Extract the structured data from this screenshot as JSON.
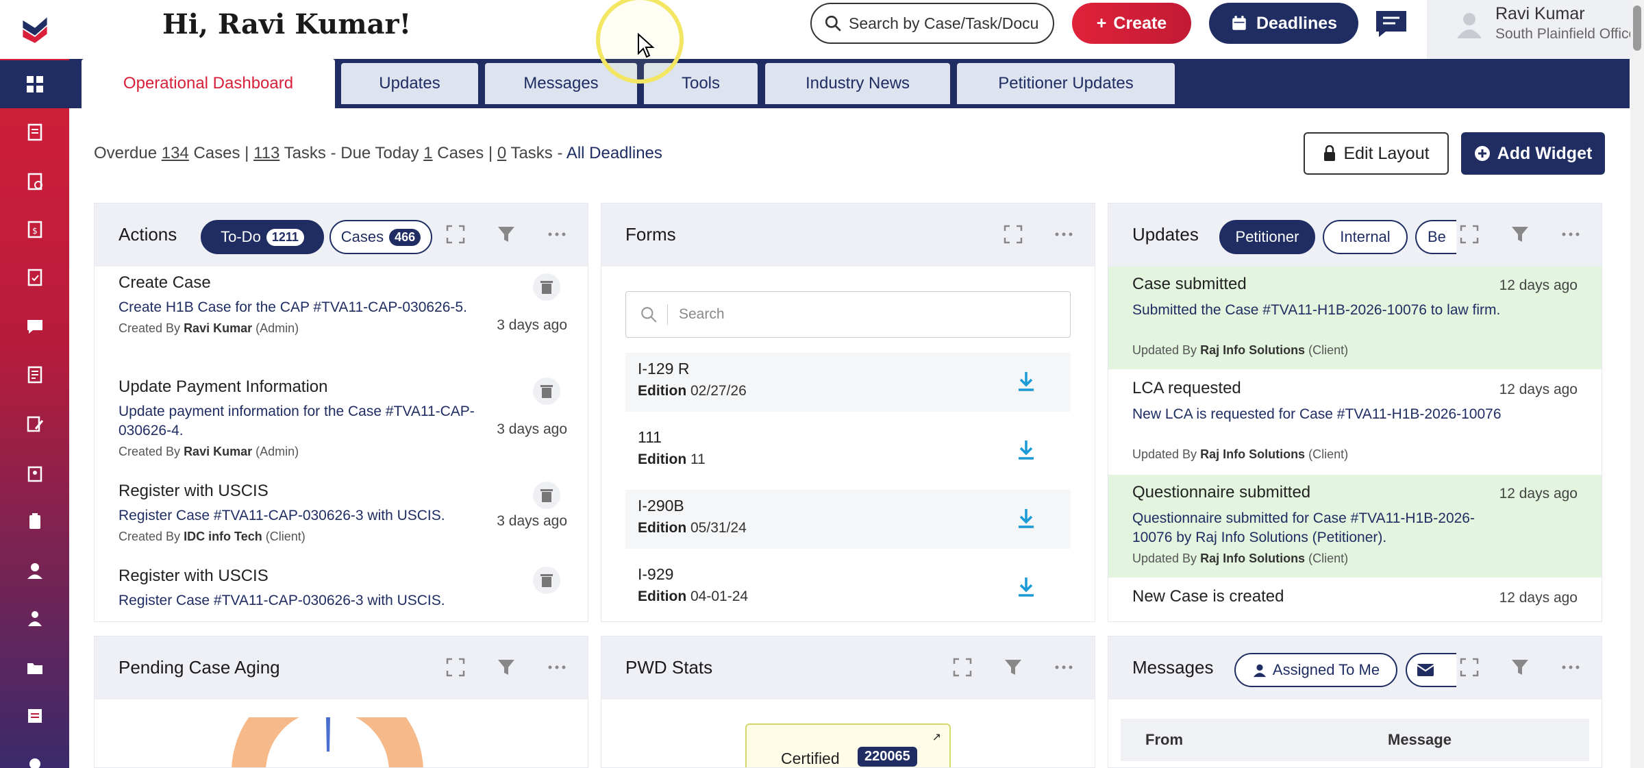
{
  "header": {
    "greeting": "Hi, Ravi Kumar!",
    "search_label": "Search by Case/Task/Docu",
    "create_label": "Create",
    "deadlines_label": "Deadlines",
    "user_name": "Ravi Kumar",
    "user_office": "South Plainfield Office"
  },
  "tabs": [
    {
      "label": "Operational Dashboard",
      "active": true
    },
    {
      "label": "Updates"
    },
    {
      "label": "Messages"
    },
    {
      "label": "Tools"
    },
    {
      "label": "Industry News"
    },
    {
      "label": "Petitioner Updates"
    }
  ],
  "stats": {
    "overdue_prefix": "Overdue",
    "overdue_cases": "134",
    "cases_sep": "Cases |",
    "overdue_tasks": "113",
    "tasks_due_today": "Tasks - Due Today",
    "due_cases": "1",
    "cases_sep2": "Cases |",
    "due_tasks": "0",
    "tasks_sep": "Tasks -",
    "all_deadlines": "All Deadlines"
  },
  "toolbar": {
    "edit_layout": "Edit Layout",
    "add_widget": "Add Widget"
  },
  "actions_widget": {
    "title": "Actions",
    "todo_label": "To-Do",
    "todo_count": "1211",
    "cases_label": "Cases",
    "cases_count": "466",
    "items": [
      {
        "title": "Create Case",
        "desc": "Create H1B Case for the CAP #TVA11-CAP-030626-5.",
        "by_prefix": "Created By",
        "by_name": "Ravi Kumar",
        "by_role": "(Admin)",
        "time": "3 days ago"
      },
      {
        "title": "Update Payment Information",
        "desc": "Update payment information for the Case #TVA11-CAP-030626-4.",
        "by_prefix": "Created By",
        "by_name": "Ravi Kumar",
        "by_role": "(Admin)",
        "time": "3 days ago"
      },
      {
        "title": "Register with USCIS",
        "desc": "Register Case #TVA11-CAP-030626-3 with USCIS.",
        "by_prefix": "Created By",
        "by_name": "IDC info Tech",
        "by_role": "(Client)",
        "time": "3 days ago"
      },
      {
        "title": "Register with USCIS",
        "desc": "Register Case #TVA11-CAP-030626-3 with USCIS.",
        "by_prefix": "",
        "by_name": "",
        "by_role": "",
        "time": ""
      }
    ]
  },
  "forms_widget": {
    "title": "Forms",
    "search_placeholder": "Search",
    "edition_label": "Edition",
    "items": [
      {
        "name": "I-129 R",
        "edition": "02/27/26"
      },
      {
        "name": "111",
        "edition": "11"
      },
      {
        "name": "I-290B",
        "edition": "05/31/24"
      },
      {
        "name": "I-929",
        "edition": "04-01-24"
      }
    ]
  },
  "updates_widget": {
    "title": "Updates",
    "pill_petitioner": "Petitioner",
    "pill_internal": "Internal",
    "pill_third": "Be",
    "items": [
      {
        "title": "Case submitted",
        "desc": "Submitted the Case #TVA11-H1B-2026-10076 to law firm.",
        "by_prefix": "Updated By",
        "by_name": "Raj Info Solutions",
        "by_role": "(Client)",
        "time": "12 days ago",
        "highlight": true
      },
      {
        "title": "LCA requested",
        "desc": "New LCA is requested for Case #TVA11-H1B-2026-10076",
        "by_prefix": "Updated By",
        "by_name": "Raj Info Solutions",
        "by_role": "(Client)",
        "time": "12 days ago",
        "highlight": false
      },
      {
        "title": "Questionnaire submitted",
        "desc": "Questionnaire submitted for Case #TVA11-H1B-2026-10076 by Raj Info Solutions (Petitioner).",
        "by_prefix": "Updated By",
        "by_name": "Raj Info Solutions",
        "by_role": "(Client)",
        "time": "12 days ago",
        "highlight": true
      },
      {
        "title": "New Case is created",
        "desc": "",
        "by_prefix": "",
        "by_name": "",
        "by_role": "",
        "time": "12 days ago",
        "highlight": false
      }
    ]
  },
  "aging_widget": {
    "title": "Pending Case Aging"
  },
  "pwd_widget": {
    "title": "PWD Stats",
    "certified_label": "Certified",
    "certified_value": "220065"
  },
  "messages_widget": {
    "title": "Messages",
    "pill_assigned": "Assigned To Me",
    "col_from": "From",
    "col_message": "Message"
  },
  "colors": {
    "brand_red": "#d9203a",
    "brand_navy": "#1f2d63",
    "update_green": "#e3f5de"
  }
}
